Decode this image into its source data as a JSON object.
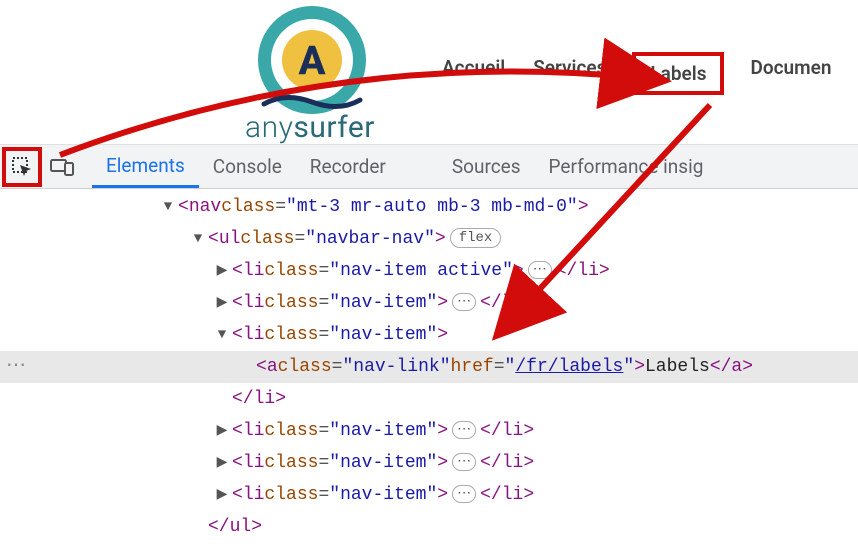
{
  "brand": {
    "name_prefix": "any",
    "name_suffix": "surfer"
  },
  "nav": {
    "accueil": "Accueil",
    "services": "Services",
    "labels": "Labels",
    "documentation": "Documen"
  },
  "devtools": {
    "tabs": {
      "elements": "Elements",
      "console": "Console",
      "recorder": "Recorder",
      "sources": "Sources",
      "perf": "Performance insig"
    }
  },
  "dom": {
    "nav_open": {
      "tag": "nav",
      "attr": "class",
      "val": "mt-3 mr-auto mb-3 mb-md-0"
    },
    "ul_open": {
      "tag": "ul",
      "attr": "class",
      "val": "navbar-nav",
      "badge": "flex"
    },
    "li_active": {
      "tag": "li",
      "attr": "class",
      "val": "nav-item active",
      "close": "</li>"
    },
    "li_item": {
      "tag": "li",
      "attr": "class",
      "val": "nav-item",
      "close": "</li>"
    },
    "a_labels": {
      "tag": "a",
      "attr1": "class",
      "val1": "nav-link",
      "attr2": "href",
      "val2": "/fr/labels",
      "text": "Labels",
      "close": "</a>"
    },
    "li_close": "</li>",
    "ul_close": "</ul>"
  }
}
